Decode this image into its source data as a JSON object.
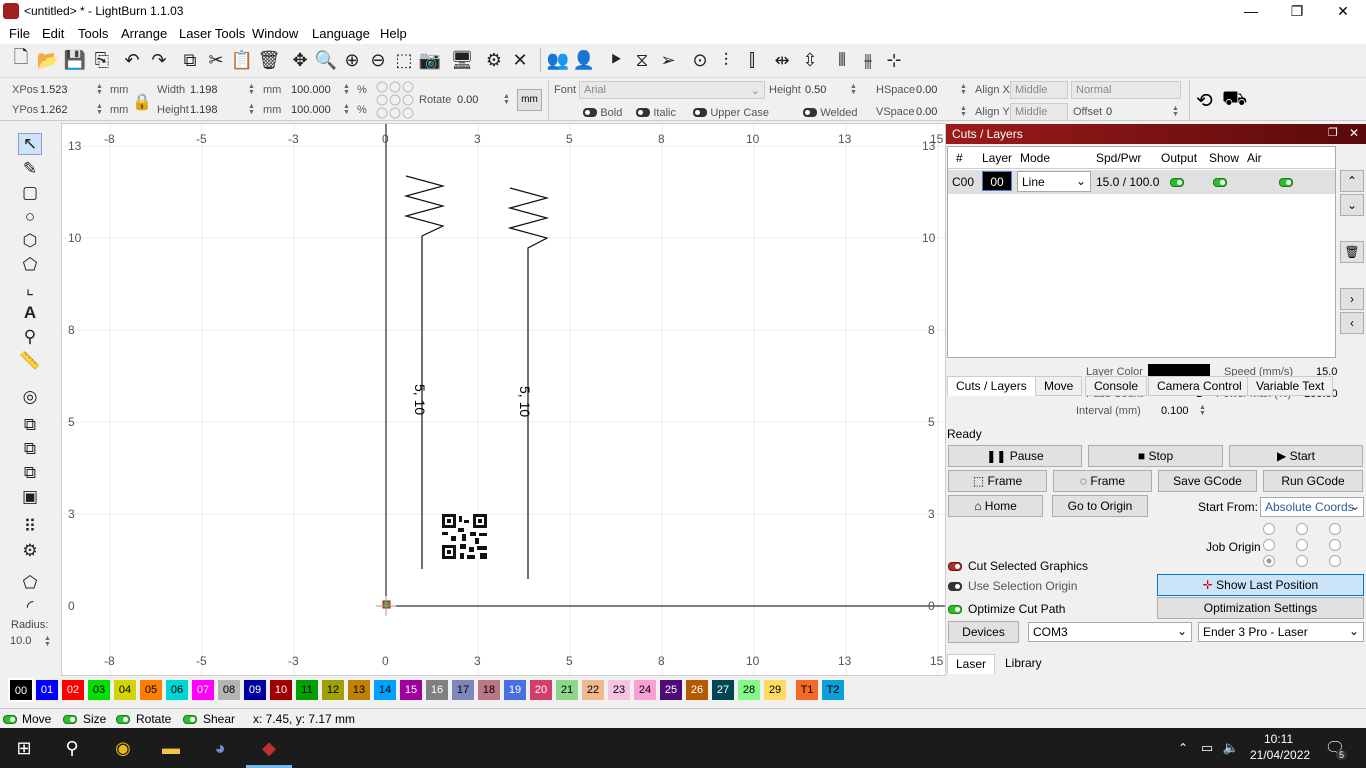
{
  "window": {
    "title": "<untitled> * - LightBurn 1.1.03",
    "min": "—",
    "max": "❐",
    "close": "✕"
  },
  "menu": [
    "File",
    "Edit",
    "Tools",
    "Arrange",
    "Laser Tools",
    "Window",
    "Language",
    "Help"
  ],
  "props": {
    "xpos_label": "XPos",
    "xpos": "1.523",
    "ypos_label": "YPos",
    "ypos": "1.262",
    "unit": "mm",
    "width_label": "Width",
    "width": "1.198",
    "height_label": "Height",
    "height": "1.198",
    "scale_w": "100.000",
    "scale_h": "100.000",
    "pct": "%",
    "rotate_label": "Rotate",
    "rotate": "0.00",
    "mm_btn": "mm",
    "font_label": "Font",
    "font": "Arial",
    "fheight_label": "Height",
    "fheight": "0.50",
    "hspace_label": "HSpace",
    "hspace": "0.00",
    "vspace_label": "VSpace",
    "vspace": "0.00",
    "alignx_label": "Align X",
    "alignx": "Middle",
    "aligny_label": "Align Y",
    "aligny": "Middle",
    "normal": "Normal",
    "offset_label": "Offset",
    "offset": "0",
    "bold": "Bold",
    "italic": "Italic",
    "upper": "Upper Case",
    "welded": "Welded"
  },
  "axis": {
    "top_ticks": [
      "-8",
      "-5",
      "-3",
      "0",
      "3",
      "5",
      "8",
      "10",
      "13",
      "15"
    ],
    "bottom_ticks": [
      "-8",
      "-5",
      "-3",
      "0",
      "3",
      "5",
      "8",
      "10",
      "13",
      "15"
    ],
    "left_ticks": [
      "13",
      "10",
      "8",
      "5",
      "3",
      "0"
    ],
    "right_ticks": [
      "13",
      "10",
      "8",
      "5",
      "3",
      "0"
    ]
  },
  "canvas_labels": [
    "5, 10",
    "5, 10"
  ],
  "left_radius_label": "Radius:",
  "left_radius": "10.0",
  "cuts": {
    "title": "Cuts / Layers",
    "headers": [
      "#",
      "Layer",
      "Mode",
      "Spd/Pwr",
      "Output",
      "Show",
      "Air"
    ],
    "row": {
      "num": "C00",
      "layer": "00",
      "mode": "Line",
      "spdpwr": "15.0 / 100.0"
    },
    "layer_color_label": "Layer Color",
    "speed_label": "Speed (mm/s)",
    "speed": "15.0",
    "pass_label": "Pass Count",
    "pass": "1",
    "powermax_label": "Power Max (%)",
    "powermax": "100.00",
    "interval_label": "Interval (mm)",
    "interval": "0.100"
  },
  "tabs": [
    "Cuts / Layers",
    "Move",
    "Console",
    "Camera Control",
    "Variable Text"
  ],
  "laser": {
    "status": "Ready",
    "pause": "Pause",
    "stop": "Stop",
    "start": "Start",
    "frame1": "Frame",
    "frame2": "Frame",
    "save_gcode": "Save GCode",
    "run_gcode": "Run GCode",
    "home": "Home",
    "go_origin": "Go to Origin",
    "start_from_label": "Start From:",
    "start_from": "Absolute Coords",
    "job_origin_label": "Job Origin",
    "cut_selected": "Cut Selected Graphics",
    "use_selection": "Use Selection Origin",
    "optimize": "Optimize Cut Path",
    "show_last": "Show Last Position",
    "opt_settings": "Optimization Settings",
    "devices": "Devices",
    "port": "COM3",
    "device": "Ender 3 Pro - Laser"
  },
  "bottom_tabs": [
    "Laser",
    "Library"
  ],
  "palette": [
    {
      "l": "00",
      "c": "#000000",
      "t": "#ffffff"
    },
    {
      "l": "01",
      "c": "#0000ff",
      "t": "#ffffff"
    },
    {
      "l": "02",
      "c": "#ff0000",
      "t": "#ffffff"
    },
    {
      "l": "03",
      "c": "#00e000",
      "t": "#000000"
    },
    {
      "l": "04",
      "c": "#d4d400",
      "t": "#000000"
    },
    {
      "l": "05",
      "c": "#ff8000",
      "t": "#000000"
    },
    {
      "l": "06",
      "c": "#00d4d4",
      "t": "#000000"
    },
    {
      "l": "07",
      "c": "#ff00ff",
      "t": "#ffffff"
    },
    {
      "l": "08",
      "c": "#b4b4b4",
      "t": "#000000"
    },
    {
      "l": "09",
      "c": "#0000a0",
      "t": "#ffffff"
    },
    {
      "l": "10",
      "c": "#a00000",
      "t": "#ffffff"
    },
    {
      "l": "11",
      "c": "#00a000",
      "t": "#000000"
    },
    {
      "l": "12",
      "c": "#a0a000",
      "t": "#000000"
    },
    {
      "l": "13",
      "c": "#c08000",
      "t": "#000000"
    },
    {
      "l": "14",
      "c": "#00a0ff",
      "t": "#000000"
    },
    {
      "l": "15",
      "c": "#a000a0",
      "t": "#ffffff"
    },
    {
      "l": "16",
      "c": "#808080",
      "t": "#ffffff"
    },
    {
      "l": "17",
      "c": "#7d87b9",
      "t": "#000000"
    },
    {
      "l": "18",
      "c": "#bb7784",
      "t": "#000000"
    },
    {
      "l": "19",
      "c": "#4a6fe3",
      "t": "#ffffff"
    },
    {
      "l": "20",
      "c": "#d33f6a",
      "t": "#ffffff"
    },
    {
      "l": "21",
      "c": "#8cd78c",
      "t": "#000000"
    },
    {
      "l": "22",
      "c": "#f0b98d",
      "t": "#000000"
    },
    {
      "l": "23",
      "c": "#f6c4e1",
      "t": "#000000"
    },
    {
      "l": "24",
      "c": "#fa9ed4",
      "t": "#000000"
    },
    {
      "l": "25",
      "c": "#500a78",
      "t": "#ffffff"
    },
    {
      "l": "26",
      "c": "#b45a00",
      "t": "#ffffff"
    },
    {
      "l": "27",
      "c": "#004754",
      "t": "#ffffff"
    },
    {
      "l": "28",
      "c": "#86fa88",
      "t": "#000000"
    },
    {
      "l": "29",
      "c": "#ffdb66",
      "t": "#000000"
    },
    {
      "l": "T1",
      "c": "#f36926",
      "t": "#000000"
    },
    {
      "l": "T2",
      "c": "#0ca0d9",
      "t": "#000000"
    }
  ],
  "status": {
    "move": "Move",
    "size": "Size",
    "rotate": "Rotate",
    "shear": "Shear",
    "coords": "x: 7.45, y: 7.17 mm"
  },
  "taskbar": {
    "time": "10:11",
    "date": "21/04/2022",
    "notif": "5"
  }
}
